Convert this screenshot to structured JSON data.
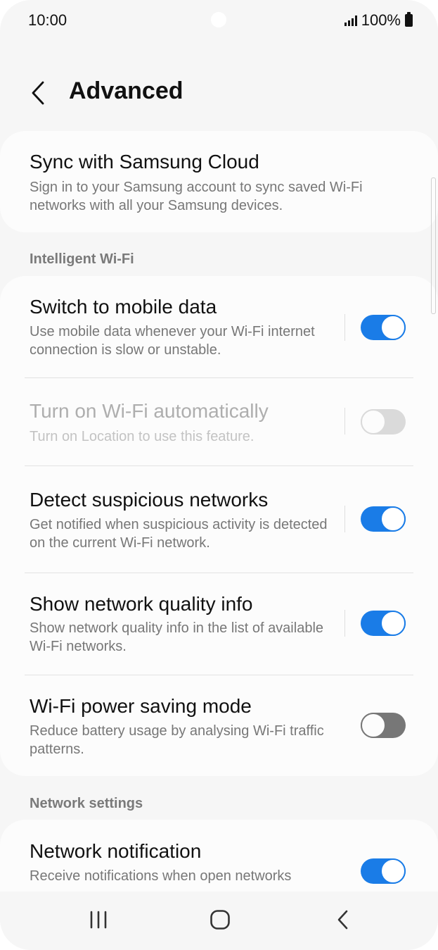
{
  "status_bar": {
    "time": "10:00",
    "battery": "100%"
  },
  "header": {
    "title": "Advanced",
    "back_icon": "chevron-left-icon"
  },
  "sync_card": {
    "title": "Sync with Samsung Cloud",
    "subtitle": "Sign in to your Samsung account to sync saved Wi-Fi networks with all your Samsung devices."
  },
  "sections": {
    "intelligent_wifi": "Intelligent Wi-Fi",
    "network_settings": "Network settings"
  },
  "intelligent_items": [
    {
      "title": "Switch to mobile data",
      "subtitle": "Use mobile data whenever your Wi-Fi internet connection is slow or unstable.",
      "enabled": true,
      "disabled": false
    },
    {
      "title": "Turn on Wi-Fi automatically",
      "subtitle": "Turn on Location to use this feature.",
      "enabled": false,
      "disabled": true
    },
    {
      "title": "Detect suspicious networks",
      "subtitle": "Get notified when suspicious activity is detected on the current Wi-Fi network.",
      "enabled": true,
      "disabled": false
    },
    {
      "title": "Show network quality info",
      "subtitle": "Show network quality info in the list of available Wi-Fi networks.",
      "enabled": true,
      "disabled": false
    },
    {
      "title": "Wi-Fi power saving mode",
      "subtitle": "Reduce battery usage by analysing Wi-Fi traffic patterns.",
      "enabled": false,
      "disabled": false
    }
  ],
  "network_items": [
    {
      "title": "Network notification",
      "subtitle": "Receive notifications when open networks",
      "enabled": true
    }
  ],
  "navbar": {
    "recents_icon": "recents-icon",
    "home_icon": "home-icon",
    "back_icon": "back-icon"
  },
  "colors": {
    "accent": "#1a7ce7",
    "background": "#f6f6f6",
    "card": "#fcfcfc"
  }
}
